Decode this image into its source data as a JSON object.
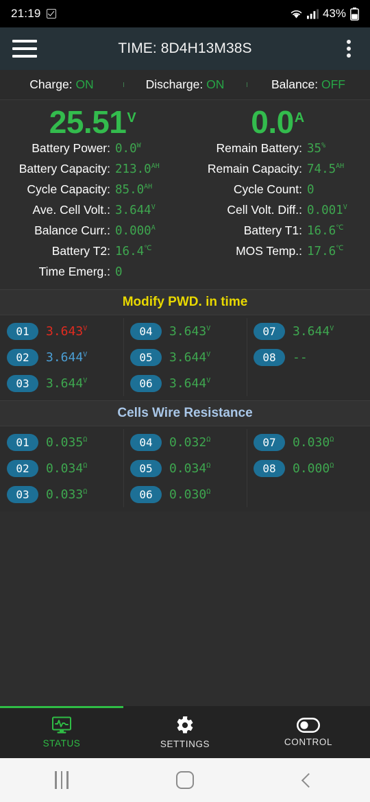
{
  "status_bar": {
    "time": "21:19",
    "battery_percent": "43%",
    "icons": [
      "checkbox-icon",
      "wifi-icon",
      "signal-icon",
      "battery-icon"
    ]
  },
  "toolbar": {
    "menu_icon": "hamburger-menu-icon",
    "title": "TIME: 8D4H13M38S",
    "overflow_icon": "kebab-menu-icon"
  },
  "switches": [
    {
      "label": "Charge:",
      "value": "ON"
    },
    {
      "label": "Discharge:",
      "value": "ON"
    },
    {
      "label": "Balance:",
      "value": "OFF"
    }
  ],
  "hero": [
    {
      "value": "25.51",
      "unit": "V"
    },
    {
      "value": "0.0",
      "unit": "A"
    }
  ],
  "stats_left": [
    {
      "label": "Battery Power:",
      "value": "0.0",
      "unit": "W"
    },
    {
      "label": "Battery Capacity:",
      "value": "213.0",
      "unit": "AH"
    },
    {
      "label": "Cycle Capacity:",
      "value": "85.0",
      "unit": "AH"
    },
    {
      "label": "Ave. Cell Volt.:",
      "value": "3.644",
      "unit": "V"
    },
    {
      "label": "Balance Curr.:",
      "value": "0.000",
      "unit": "A"
    },
    {
      "label": "Battery T2:",
      "value": "16.4",
      "unit": "℃"
    },
    {
      "label": "Time Emerg.:",
      "value": "0",
      "unit": ""
    }
  ],
  "stats_right": [
    {
      "label": "Remain Battery:",
      "value": "35",
      "unit": "%"
    },
    {
      "label": "Remain Capacity:",
      "value": "74.5",
      "unit": "AH"
    },
    {
      "label": "Cycle Count:",
      "value": "0",
      "unit": ""
    },
    {
      "label": "Cell Volt. Diff.:",
      "value": "0.001",
      "unit": "V"
    },
    {
      "label": "Battery T1:",
      "value": "16.6",
      "unit": "℃"
    },
    {
      "label": "MOS Temp.:",
      "value": "17.6",
      "unit": "℃"
    }
  ],
  "cell_voltage": {
    "header": "Modify PWD. in time",
    "header_color": "#e8d800",
    "columns": [
      [
        {
          "id": "01",
          "value": "3.643",
          "unit": "V",
          "state": "low"
        },
        {
          "id": "02",
          "value": "3.644",
          "unit": "V",
          "state": "high"
        },
        {
          "id": "03",
          "value": "3.644",
          "unit": "V",
          "state": "normal"
        }
      ],
      [
        {
          "id": "04",
          "value": "3.643",
          "unit": "V",
          "state": "normal"
        },
        {
          "id": "05",
          "value": "3.644",
          "unit": "V",
          "state": "normal"
        },
        {
          "id": "06",
          "value": "3.644",
          "unit": "V",
          "state": "normal"
        }
      ],
      [
        {
          "id": "07",
          "value": "3.644",
          "unit": "V",
          "state": "normal"
        },
        {
          "id": "08",
          "value": "--",
          "unit": "",
          "state": "normal"
        }
      ]
    ]
  },
  "cell_resistance": {
    "header": "Cells Wire Resistance",
    "header_color": "#a9c7e8",
    "columns": [
      [
        {
          "id": "01",
          "value": "0.035",
          "unit": "Ω",
          "state": "normal"
        },
        {
          "id": "02",
          "value": "0.034",
          "unit": "Ω",
          "state": "normal"
        },
        {
          "id": "03",
          "value": "0.033",
          "unit": "Ω",
          "state": "normal"
        }
      ],
      [
        {
          "id": "04",
          "value": "0.032",
          "unit": "Ω",
          "state": "normal"
        },
        {
          "id": "05",
          "value": "0.034",
          "unit": "Ω",
          "state": "normal"
        },
        {
          "id": "06",
          "value": "0.030",
          "unit": "Ω",
          "state": "normal"
        }
      ],
      [
        {
          "id": "07",
          "value": "0.030",
          "unit": "Ω",
          "state": "normal"
        },
        {
          "id": "08",
          "value": "0.000",
          "unit": "Ω",
          "state": "normal"
        }
      ]
    ]
  },
  "tabs": [
    {
      "label": "STATUS",
      "icon": "monitor-pulse-icon",
      "active": true
    },
    {
      "label": "SETTINGS",
      "icon": "gear-icon",
      "active": false
    },
    {
      "label": "CONTROL",
      "icon": "toggle-switch-icon",
      "active": false
    }
  ],
  "nav_bar": {
    "recents_icon": "recents-icon",
    "home_icon": "home-icon",
    "back_icon": "back-icon"
  },
  "colors": {
    "accent_green": "#2fbd45",
    "value_green": "#3ea64f",
    "low_red": "#e02b20",
    "high_blue": "#4b9fd5",
    "badge_blue": "#1d7096",
    "toolbar": "#263238",
    "background": "#2e2e2e"
  }
}
